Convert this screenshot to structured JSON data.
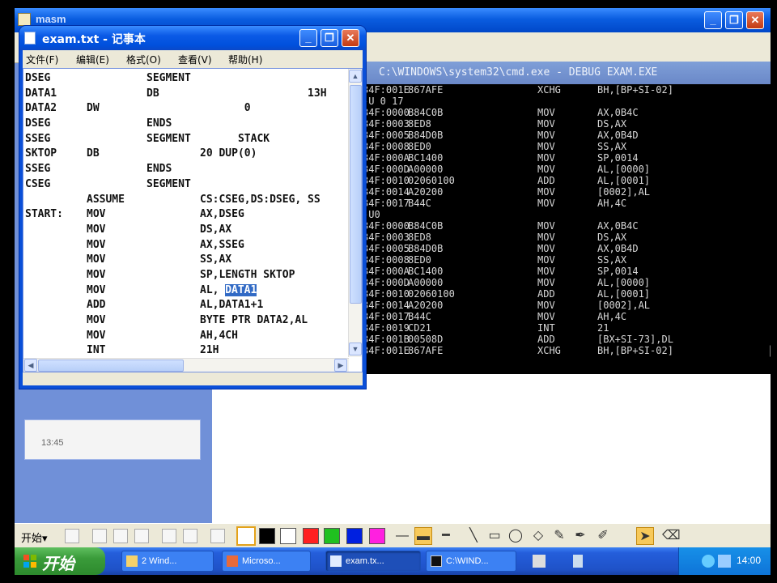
{
  "background_window": {
    "title": "masm",
    "panel_time": "13:45",
    "minimize": "_",
    "maximize": "❐",
    "close": "✕"
  },
  "notepad": {
    "title": "exam.txt - 记事本",
    "menu": [
      "文件(F)",
      "编辑(E)",
      "格式(O)",
      "查看(V)",
      "帮助(H)"
    ],
    "lines": [
      [
        "DSEG",
        "",
        "SEGMENT",
        ""
      ],
      [
        "DATA1",
        "",
        "DB",
        "                 13H"
      ],
      [
        "DATA2",
        "DW",
        "",
        "       0"
      ],
      [
        "DSEG",
        "",
        "ENDS",
        ""
      ],
      [
        "SSEG",
        "",
        "SEGMENT",
        "      STACK"
      ],
      [
        "SKTOP",
        "DB",
        "",
        "20 DUP(0)"
      ],
      [
        "SSEG",
        "",
        "ENDS",
        ""
      ],
      [
        "CSEG",
        "",
        "SEGMENT",
        ""
      ],
      [
        "",
        "ASSUME",
        "",
        "CS:CSEG,DS:DSEG, SS"
      ],
      [
        "START:",
        "MOV",
        "",
        "AX,DSEG"
      ],
      [
        "",
        "MOV",
        "",
        "DS,AX"
      ],
      [
        "",
        "MOV",
        "",
        "AX,SSEG"
      ],
      [
        "",
        "MOV",
        "",
        "SS,AX"
      ],
      [
        "",
        "MOV",
        "",
        "SP,LENGTH SKTOP"
      ],
      [
        "",
        "MOV",
        "",
        "AL,"
      ],
      [
        "",
        "ADD",
        "",
        "AL,DATA1+1"
      ],
      [
        "",
        "MOV",
        "",
        "BYTE PTR DATA2,AL"
      ],
      [
        "",
        "MOV",
        "",
        "AH,4CH"
      ],
      [
        "",
        "INT",
        "",
        "21H"
      ]
    ],
    "selected_text": "DATA1"
  },
  "cmd": {
    "title": "C:\\WINDOWS\\system32\\cmd.exe - DEBUG EXAM.EXE",
    "rows": [
      [
        "34F:001E",
        "867AFE",
        "XCHG",
        "BH,[BP+SI-02]"
      ],
      [
        "-U 0 17",
        "",
        "",
        ""
      ],
      [
        "34F:0000",
        "B84C0B",
        "MOV",
        "AX,0B4C"
      ],
      [
        "34F:0003",
        "8ED8",
        "MOV",
        "DS,AX"
      ],
      [
        "34F:0005",
        "B84D0B",
        "MOV",
        "AX,0B4D"
      ],
      [
        "34F:0008",
        "8ED0",
        "MOV",
        "SS,AX"
      ],
      [
        "34F:000A",
        "BC1400",
        "MOV",
        "SP,0014"
      ],
      [
        "34F:000D",
        "A00000",
        "MOV",
        "AL,[0000]"
      ],
      [
        "34F:0010",
        "02060100",
        "ADD",
        "AL,[0001]"
      ],
      [
        "34F:0014",
        "A20200",
        "MOV",
        "[0002],AL"
      ],
      [
        "34F:0017",
        "B44C",
        "MOV",
        "AH,4C"
      ],
      [
        "-U0",
        "",
        "",
        ""
      ],
      [
        "34F:0000",
        "B84C0B",
        "MOV",
        "AX,0B4C"
      ],
      [
        "34F:0003",
        "8ED8",
        "MOV",
        "DS,AX"
      ],
      [
        "34F:0005",
        "B84D0B",
        "MOV",
        "AX,0B4D"
      ],
      [
        "34F:0008",
        "8ED0",
        "MOV",
        "SS,AX"
      ],
      [
        "34F:000A",
        "BC1400",
        "MOV",
        "SP,0014"
      ],
      [
        "34F:000D",
        "A00000",
        "MOV",
        "AL,[0000]"
      ],
      [
        "34F:0010",
        "02060100",
        "ADD",
        "AL,[0001]"
      ],
      [
        "34F:0014",
        "A20200",
        "MOV",
        "[0002],AL"
      ],
      [
        "34F:0017",
        "B44C",
        "MOV",
        "AH,4C"
      ],
      [
        "34F:0019",
        "CD21",
        "INT",
        "21"
      ],
      [
        "34F:001B",
        "00508D",
        "ADD",
        "[BX+SI-73],DL"
      ],
      [
        "34F:001E",
        "867AFE",
        "XCHG",
        "BH,[BP+SI-02]"
      ]
    ]
  },
  "drawbar": {
    "start_label": "开始▾",
    "colors": [
      "#ffffff",
      "#000000",
      "#ffffff",
      "#ff2020",
      "#20c020",
      "#0020e0",
      "#ff20e0"
    ],
    "tool_icons": [
      "line-thin-icon",
      "line-medium-icon",
      "line-thick-icon",
      "pen-icon",
      "rectangle-icon",
      "ellipse-icon",
      "eraser-icon",
      "highlighter-icon",
      "pointer-icon",
      "clear-icon"
    ]
  },
  "taskbar": {
    "start": "开始",
    "tasks": [
      "2 Wind...",
      "Microso...",
      "exam.tx...",
      "C:\\WIND..."
    ],
    "time": "14:00"
  }
}
